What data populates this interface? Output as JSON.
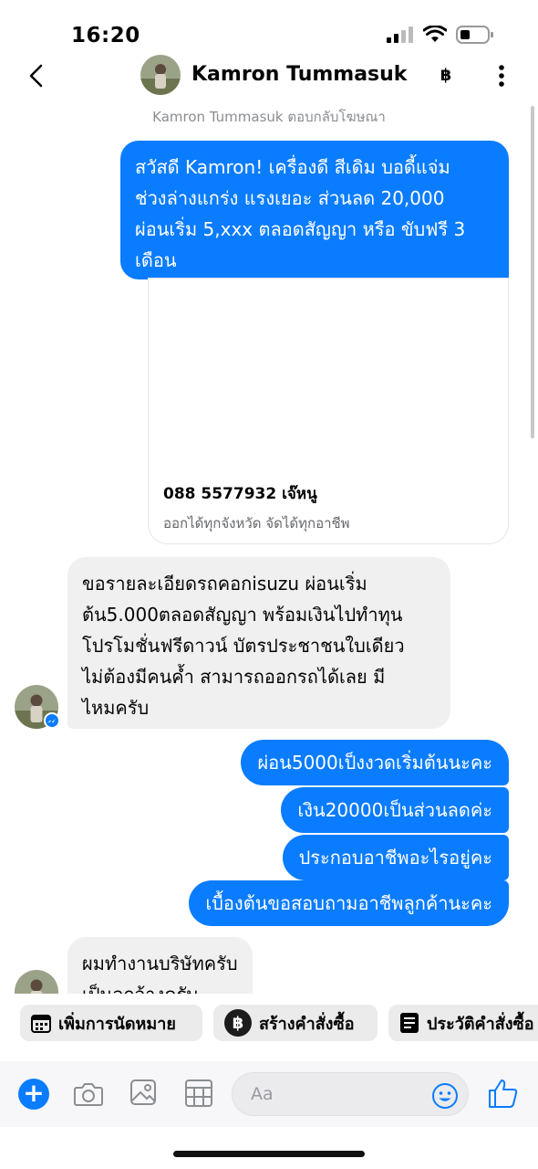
{
  "status_bar": {
    "time": "16:20"
  },
  "header": {
    "name": "Kamron Tummasuk",
    "baht_symbol": "฿"
  },
  "ad_reply_note": "Kamron Tummasuk ตอบกลับโฆษณา",
  "messages": [
    {
      "from": "me",
      "lines": [
        "สวัสดี Kamron! เครื่องดี สีเดิม บอดี้แจ่ม",
        "ช่วงล่างแกร่ง แรงเยอะ ส่วนลด 20,000",
        "ผ่อนเริ่ม 5,xxx ตลอดสัญญา หรือ ขับฟรี 3",
        "เดือน"
      ]
    },
    {
      "from": "them",
      "lines": [
        "ขอรายละเอียดรถคอกisuzu ผ่อนเริ่ม",
        "ต้น5.000ตลอดสัญญา พร้อมเงินไปทำทุน",
        "โปรโมชั่นฟรีดาวน์ บัตรประชาชนใบเดียว",
        "ไม่ต้องมีคนค้ำ สามารถออกรถได้เลย มี",
        "ไหมครับ"
      ]
    },
    {
      "from": "me",
      "text": "ผ่อน5000เป็งงวดเริ่มต้นนะคะ"
    },
    {
      "from": "me",
      "text": "เงิน20000เป็นส่วนลดค่ะ"
    },
    {
      "from": "me",
      "text": "ประกอบอาชีพอะไรอยู่คะ"
    },
    {
      "from": "me",
      "text": "เบื้องต้นขอสอบถามอาชีพลูกค้านะคะ"
    },
    {
      "from": "them",
      "lines": [
        "ผมทำงานบริษัทครับ",
        "เป็นลูกจ้างครับ"
      ]
    }
  ],
  "ad_card": {
    "title": "088 5577932 เจ๊หนู",
    "subtitle": "ออกได้ทุกจังหวัด จัดได้ทุกอาชีพ"
  },
  "quick_actions": [
    {
      "label": "เพิ่มการนัดหมาย",
      "icon": "calendar-icon"
    },
    {
      "label": "สร้างคำสั่งซื้อ",
      "icon": "baht-icon"
    },
    {
      "label": "ประวัติคำสั่งซื้อ",
      "icon": "receipt-icon"
    }
  ],
  "composer": {
    "placeholder": "Aa"
  },
  "colors": {
    "accent": "#0a7cff",
    "incoming_bubble": "#f0f0f0"
  }
}
